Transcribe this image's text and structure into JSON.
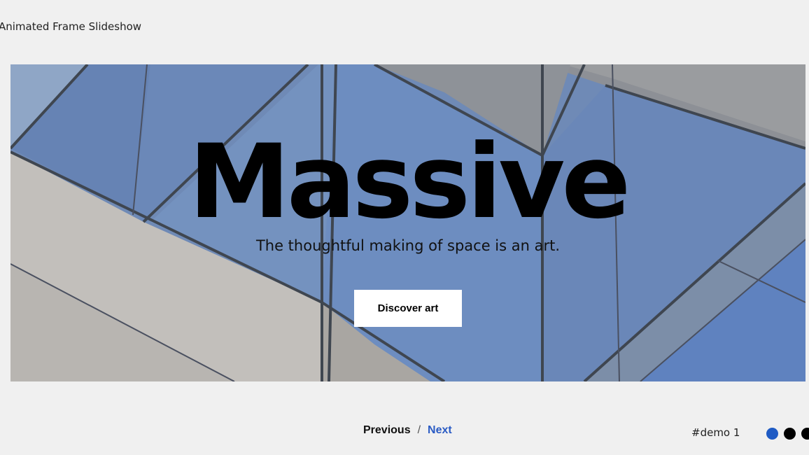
{
  "page": {
    "title": "Animated Frame Slideshow"
  },
  "slide": {
    "heading": "Massive",
    "subtitle": "The thoughtful making of space is an art.",
    "cta_label": "Discover art"
  },
  "navigation": {
    "previous_label": "Previous",
    "separator": "/",
    "next_label": "Next",
    "next_color": "#2a5bc4"
  },
  "demo": {
    "label": "#demo 1"
  },
  "pagination": {
    "dots": [
      {
        "active": true,
        "color": "#1f5bc4"
      },
      {
        "active": false,
        "color": "#000000"
      },
      {
        "active": false,
        "color": "#000000"
      }
    ]
  },
  "colors": {
    "background": "#f0f0f0",
    "glass": "#6b87b8",
    "concrete": "#bfbcb8"
  }
}
